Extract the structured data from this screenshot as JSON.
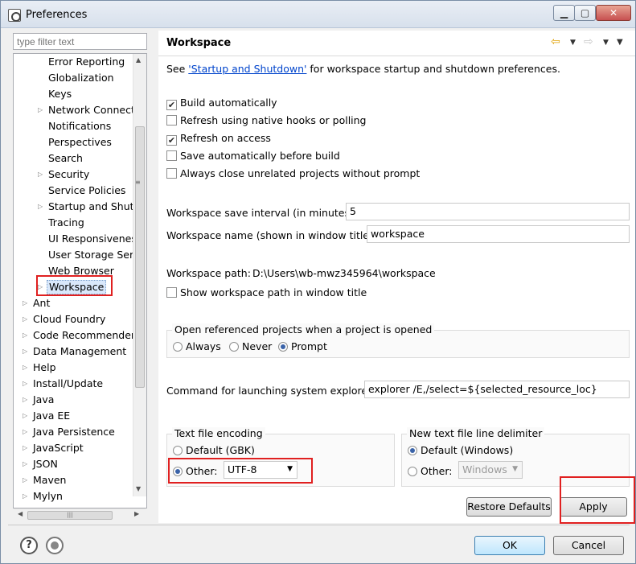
{
  "window": {
    "title": "Preferences"
  },
  "window_buttons": {
    "minimize": "▁",
    "maximize": "▢",
    "close": "✕"
  },
  "filter": {
    "placeholder": "type filter text"
  },
  "tree": {
    "children": [
      {
        "label": "Error Reporting",
        "expandable": false
      },
      {
        "label": "Globalization",
        "expandable": false
      },
      {
        "label": "Keys",
        "expandable": false
      },
      {
        "label": "Network Connections",
        "expandable": true
      },
      {
        "label": "Notifications",
        "expandable": false
      },
      {
        "label": "Perspectives",
        "expandable": false
      },
      {
        "label": "Search",
        "expandable": false
      },
      {
        "label": "Security",
        "expandable": true
      },
      {
        "label": "Service Policies",
        "expandable": false
      },
      {
        "label": "Startup and Shutdown",
        "expandable": true
      },
      {
        "label": "Tracing",
        "expandable": false
      },
      {
        "label": "UI Responsiveness",
        "expandable": false
      },
      {
        "label": "User Storage Service",
        "expandable": false
      },
      {
        "label": "Web Browser",
        "expandable": false
      },
      {
        "label": "Workspace",
        "expandable": true,
        "selected": true
      }
    ],
    "roots": [
      "Ant",
      "Cloud Foundry",
      "Code Recommenders",
      "Data Management",
      "Help",
      "Install/Update",
      "Java",
      "Java EE",
      "Java Persistence",
      "JavaScript",
      "JSON",
      "Maven",
      "Mylyn"
    ]
  },
  "panel": {
    "title": "Workspace",
    "desc_prefix": "See ",
    "desc_link": "'Startup and Shutdown'",
    "desc_suffix": " for workspace startup and shutdown preferences.",
    "checkboxes": [
      {
        "label": "Build automatically",
        "checked": true
      },
      {
        "label": "Refresh using native hooks or polling",
        "checked": false
      },
      {
        "label": "Refresh on access",
        "checked": true
      },
      {
        "label": "Save automatically before build",
        "checked": false
      },
      {
        "label": "Always close unrelated projects without prompt",
        "checked": false
      }
    ],
    "save_interval_label": "Workspace save interval (in minutes):",
    "save_interval_value": "5",
    "ws_name_label": "Workspace name (shown in window title):",
    "ws_name_value": "workspace",
    "ws_path_label": "Workspace path:",
    "ws_path_value": "D:\\Users\\wb-mwz345964\\workspace",
    "show_path_label": "Show workspace path in window title",
    "open_ref_title": "Open referenced projects when a project is opened",
    "open_ref_options": [
      "Always",
      "Never",
      "Prompt"
    ],
    "open_ref_selected": "Prompt",
    "cmd_label": "Command for launching system explorer:",
    "cmd_value": "explorer /E,/select=${selected_resource_loc}",
    "encoding_title": "Text file encoding",
    "encoding_default": "Default (GBK)",
    "encoding_other": "Other:",
    "encoding_value": "UTF-8",
    "delim_title": "New text file line delimiter",
    "delim_default": "Default (Windows)",
    "delim_other": "Other:",
    "delim_value": "Windows",
    "restore_label": "Restore Defaults",
    "apply_label": "Apply"
  },
  "dialog": {
    "ok_label": "OK",
    "cancel_label": "Cancel"
  },
  "colors": {
    "accent_red": "#e02020",
    "link": "#0044cc",
    "radio_dot": "#3a63a8"
  }
}
